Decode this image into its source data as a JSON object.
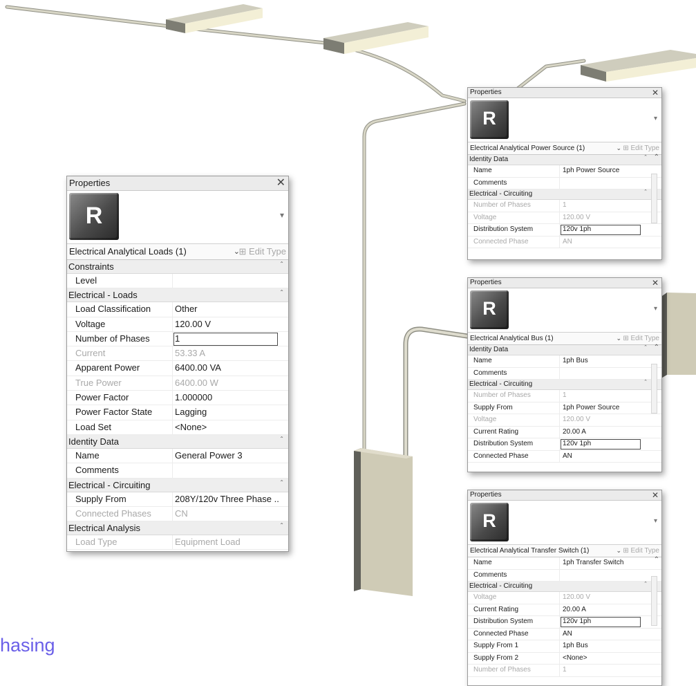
{
  "caption": "hasing",
  "colors": {
    "caption": "#6a5fe8",
    "disabled_text": "#a9a9a9",
    "group_bg": "#eeeeee"
  },
  "icons": {
    "revit_logo": "R",
    "close": "close-icon",
    "dropdown": "chevron-down-icon"
  },
  "panels": [
    {
      "title": "Properties",
      "close": "✕",
      "logo": "R",
      "type_name": "Electrical Analytical Loads (1)",
      "edit_type": "Edit Type",
      "groups": [
        {
          "label": "Constraints",
          "rows": [
            {
              "name": "Level",
              "value": "",
              "disabled": false,
              "boxed": false
            }
          ]
        },
        {
          "label": "Electrical - Loads",
          "rows": [
            {
              "name": "Load Classification",
              "value": "Other",
              "disabled": false,
              "boxed": false
            },
            {
              "name": "Voltage",
              "value": "120.00 V",
              "disabled": false,
              "boxed": false
            },
            {
              "name": "Number of Phases",
              "value": "1",
              "disabled": false,
              "boxed": true
            },
            {
              "name": "Current",
              "value": "53.33 A",
              "disabled": true,
              "boxed": false
            },
            {
              "name": "Apparent Power",
              "value": "6400.00 VA",
              "disabled": false,
              "boxed": false
            },
            {
              "name": "True Power",
              "value": "6400.00 W",
              "disabled": true,
              "boxed": false
            },
            {
              "name": "Power Factor",
              "value": "1.000000",
              "disabled": false,
              "boxed": false
            },
            {
              "name": "Power Factor State",
              "value": "Lagging",
              "disabled": false,
              "boxed": false
            },
            {
              "name": "Load Set",
              "value": "<None>",
              "disabled": false,
              "boxed": false
            }
          ]
        },
        {
          "label": "Identity Data",
          "rows": [
            {
              "name": "Name",
              "value": "General Power 3",
              "disabled": false,
              "boxed": false
            },
            {
              "name": "Comments",
              "value": "",
              "disabled": false,
              "boxed": false
            }
          ]
        },
        {
          "label": "Electrical - Circuiting",
          "rows": [
            {
              "name": "Supply From",
              "value": "208Y/120v Three Phase ...",
              "disabled": false,
              "boxed": false
            },
            {
              "name": "Connected Phases",
              "value": "CN",
              "disabled": true,
              "boxed": false
            }
          ]
        },
        {
          "label": "Electrical Analysis",
          "rows": [
            {
              "name": "Load Type",
              "value": "Equipment Load",
              "disabled": true,
              "boxed": false
            }
          ]
        }
      ]
    },
    {
      "title": "Properties",
      "close": "✕",
      "logo": "R",
      "type_name": "Electrical Analytical Power Source (1)",
      "edit_type": "Edit Type",
      "groups": [
        {
          "label": "Identity Data",
          "rows": [
            {
              "name": "Name",
              "value": "1ph Power Source",
              "disabled": false,
              "boxed": false
            },
            {
              "name": "Comments",
              "value": "",
              "disabled": false,
              "boxed": false
            }
          ]
        },
        {
          "label": "Electrical - Circuiting",
          "rows": [
            {
              "name": "Number of Phases",
              "value": "1",
              "disabled": true,
              "boxed": false
            },
            {
              "name": "Voltage",
              "value": "120.00 V",
              "disabled": true,
              "boxed": false
            },
            {
              "name": "Distribution System",
              "value": "120v 1ph",
              "disabled": false,
              "boxed": true
            },
            {
              "name": "Connected Phase",
              "value": "AN",
              "disabled": true,
              "boxed": false
            }
          ]
        }
      ]
    },
    {
      "title": "Properties",
      "close": "✕",
      "logo": "R",
      "type_name": "Electrical Analytical Bus (1)",
      "edit_type": "Edit Type",
      "groups": [
        {
          "label": "Identity Data",
          "rows": [
            {
              "name": "Name",
              "value": "1ph Bus",
              "disabled": false,
              "boxed": false
            },
            {
              "name": "Comments",
              "value": "",
              "disabled": false,
              "boxed": false
            }
          ]
        },
        {
          "label": "Electrical - Circuiting",
          "rows": [
            {
              "name": "Number of Phases",
              "value": "1",
              "disabled": true,
              "boxed": false
            },
            {
              "name": "Supply From",
              "value": "1ph Power Source",
              "disabled": false,
              "boxed": false
            },
            {
              "name": "Voltage",
              "value": "120.00 V",
              "disabled": true,
              "boxed": false
            },
            {
              "name": "Current Rating",
              "value": "20.00 A",
              "disabled": false,
              "boxed": false
            },
            {
              "name": "Distribution System",
              "value": "120v 1ph",
              "disabled": false,
              "boxed": true
            },
            {
              "name": "Connected Phase",
              "value": "AN",
              "disabled": false,
              "boxed": false
            }
          ]
        }
      ]
    },
    {
      "title": "Properties",
      "close": "✕",
      "logo": "R",
      "type_name": "Electrical Analytical Transfer Switch (1)",
      "edit_type": "Edit Type",
      "groups": [
        {
          "label": "",
          "rows": [
            {
              "name": "Name",
              "value": "1ph Transfer Switch",
              "disabled": false,
              "boxed": false
            },
            {
              "name": "Comments",
              "value": "",
              "disabled": false,
              "boxed": false
            }
          ]
        },
        {
          "label": "Electrical - Circuiting",
          "rows": [
            {
              "name": "Voltage",
              "value": "120.00 V",
              "disabled": true,
              "boxed": false
            },
            {
              "name": "Current Rating",
              "value": "20.00 A",
              "disabled": false,
              "boxed": false
            },
            {
              "name": "Distribution System",
              "value": "120v 1ph",
              "disabled": false,
              "boxed": true
            },
            {
              "name": "Connected Phase",
              "value": "AN",
              "disabled": false,
              "boxed": false
            },
            {
              "name": "Supply From 1",
              "value": "1ph Bus",
              "disabled": false,
              "boxed": false
            },
            {
              "name": "Supply From 2",
              "value": "<None>",
              "disabled": false,
              "boxed": false
            },
            {
              "name": "Number of Phases",
              "value": "1",
              "disabled": true,
              "boxed": false
            }
          ]
        }
      ]
    }
  ]
}
